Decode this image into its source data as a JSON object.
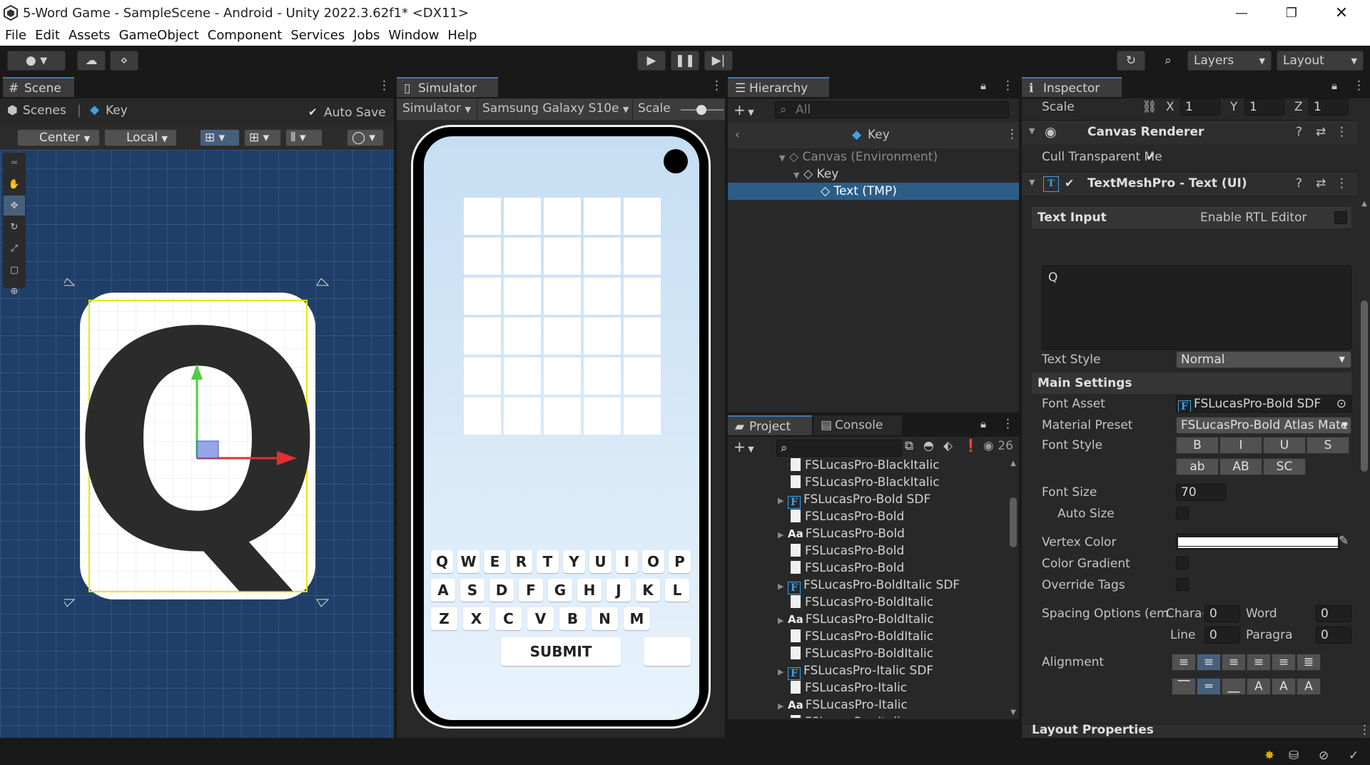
{
  "window": {
    "title": "5-Word Game - SampleScene - Android - Unity 2022.3.62f1* <DX11>"
  },
  "menu": [
    "File",
    "Edit",
    "Assets",
    "GameObject",
    "Component",
    "Services",
    "Jobs",
    "Window",
    "Help"
  ],
  "toolbar": {
    "layers": "Layers",
    "layout": "Layout"
  },
  "scene": {
    "tab": "Scene",
    "breadcrumb_root": "Scenes",
    "breadcrumb_item": "Key",
    "auto_save": "Auto Save",
    "pivot": "Center",
    "space": "Local",
    "letter": "Q"
  },
  "simulator": {
    "tab": "Simulator",
    "mode": "Simulator",
    "device": "Samsung Galaxy S10e",
    "scale": "Scale",
    "keyboard": {
      "row1": [
        "Q",
        "W",
        "E",
        "R",
        "T",
        "Y",
        "U",
        "I",
        "O",
        "P"
      ],
      "row2": [
        "A",
        "S",
        "D",
        "F",
        "G",
        "H",
        "J",
        "K",
        "L"
      ],
      "row3": [
        "Z",
        "X",
        "C",
        "V",
        "B",
        "N",
        "M"
      ],
      "submit": "SUBMIT"
    }
  },
  "hierarchy": {
    "tab": "Hierarchy",
    "search_placeholder": "All",
    "header": "Key",
    "items": [
      {
        "label": "Canvas (Environment)"
      },
      {
        "label": "Key"
      },
      {
        "label": "Text (TMP)"
      }
    ]
  },
  "project": {
    "tab": "Project",
    "console_tab": "Console",
    "count": "26",
    "items": [
      {
        "label": "FSLucasPro-BlackItalic",
        "icon": "file"
      },
      {
        "label": "FSLucasPro-BlackItalic",
        "icon": "file"
      },
      {
        "label": "FSLucasPro-Bold SDF",
        "icon": "font-asset"
      },
      {
        "label": "FSLucasPro-Bold",
        "icon": "file"
      },
      {
        "label": "FSLucasPro-Bold",
        "icon": "font"
      },
      {
        "label": "FSLucasPro-Bold",
        "icon": "file"
      },
      {
        "label": "FSLucasPro-Bold",
        "icon": "file"
      },
      {
        "label": "FSLucasPro-BoldItalic SDF",
        "icon": "font-asset"
      },
      {
        "label": "FSLucasPro-BoldItalic",
        "icon": "file"
      },
      {
        "label": "FSLucasPro-BoldItalic",
        "icon": "font"
      },
      {
        "label": "FSLucasPro-BoldItalic",
        "icon": "file"
      },
      {
        "label": "FSLucasPro-BoldItalic",
        "icon": "file"
      },
      {
        "label": "FSLucasPro-Italic SDF",
        "icon": "font-asset"
      },
      {
        "label": "FSLucasPro-Italic",
        "icon": "file"
      },
      {
        "label": "FSLucasPro-Italic",
        "icon": "font"
      },
      {
        "label": "FSLucasPro-Italic",
        "icon": "file"
      }
    ]
  },
  "inspector": {
    "tab": "Inspector",
    "scale": {
      "label": "Scale",
      "x_label": "X",
      "x": "1",
      "y_label": "Y",
      "y": "1",
      "z_label": "Z",
      "z": "1"
    },
    "canvas_renderer": {
      "title": "Canvas Renderer",
      "cull_label": "Cull Transparent Me"
    },
    "tmp": {
      "title": "TextMeshPro - Text (UI)",
      "text_input": "Text Input",
      "rtl": "Enable RTL Editor",
      "text_value": "Q",
      "text_style_label": "Text Style",
      "text_style": "Normal",
      "main_settings": "Main Settings",
      "font_asset_label": "Font Asset",
      "font_asset": "FSLucasPro-Bold SDF",
      "material_label": "Material Preset",
      "material": "FSLucasPro-Bold Atlas Mate",
      "font_style_label": "Font Style",
      "styles1": [
        "B",
        "I",
        "U",
        "S"
      ],
      "styles2": [
        "ab",
        "AB",
        "SC"
      ],
      "font_size_label": "Font Size",
      "font_size": "70",
      "auto_size_label": "Auto Size",
      "vertex_color_label": "Vertex Color",
      "color_gradient_label": "Color Gradient",
      "override_tags_label": "Override Tags",
      "spacing_label": "Spacing Options (em",
      "charac_label": "Charac",
      "charac": "0",
      "word_label": "Word",
      "word": "0",
      "line_label": "Line",
      "line": "0",
      "para_label": "Paragra",
      "para": "0",
      "alignment_label": "Alignment"
    },
    "layout_properties": "Layout Properties"
  }
}
